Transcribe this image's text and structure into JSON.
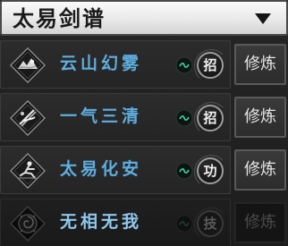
{
  "header": {
    "title": "太易剑谱",
    "dropdown_icon": "triangle-down-icon"
  },
  "skills": [
    {
      "name": "云山幻雾",
      "type_icon": "wave-icon",
      "badge": "招",
      "action": "修炼",
      "enabled": true,
      "icon": "mountain-mist-icon"
    },
    {
      "name": "一气三清",
      "type_icon": "wave-icon",
      "badge": "招",
      "action": "修炼",
      "enabled": true,
      "icon": "three-swords-icon"
    },
    {
      "name": "太易化安",
      "type_icon": "wave-icon",
      "badge": "功",
      "action": "修炼",
      "enabled": true,
      "icon": "crouching-figure-icon"
    },
    {
      "name": "无相无我",
      "type_icon": "wave-icon",
      "badge": "技",
      "action": "修炼",
      "enabled": false,
      "icon": "vortex-icon"
    }
  ],
  "colors": {
    "skill_name": "#5faee0",
    "wave_icon": "#3fd3a8",
    "panel_bg": "#1c1c1c"
  }
}
